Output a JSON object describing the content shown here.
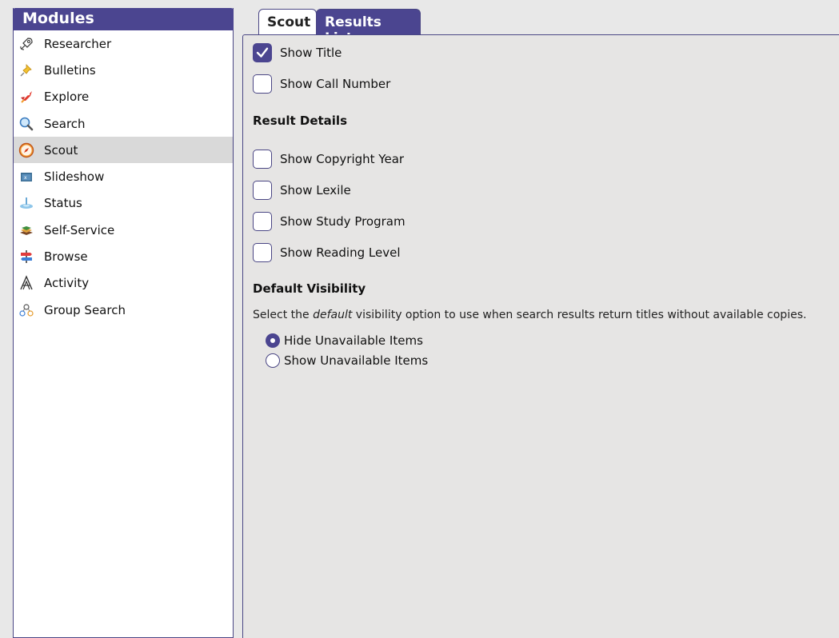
{
  "sidebar": {
    "header": "Modules",
    "items": [
      {
        "label": "Researcher",
        "icon": "rocket-outline-icon"
      },
      {
        "label": "Bulletins",
        "icon": "pushpin-icon"
      },
      {
        "label": "Explore",
        "icon": "rocket-icon"
      },
      {
        "label": "Search",
        "icon": "magnifier-icon"
      },
      {
        "label": "Scout",
        "icon": "compass-icon",
        "selected": true
      },
      {
        "label": "Slideshow",
        "icon": "slideshow-icon"
      },
      {
        "label": "Status",
        "icon": "status-icon"
      },
      {
        "label": "Self-Service",
        "icon": "books-icon"
      },
      {
        "label": "Browse",
        "icon": "signpost-icon"
      },
      {
        "label": "Activity",
        "icon": "activity-a-icon"
      },
      {
        "label": "Group Search",
        "icon": "group-icon"
      }
    ]
  },
  "tabs": [
    {
      "label": "Scout",
      "active": false
    },
    {
      "label": "Results List",
      "active": true
    }
  ],
  "content": {
    "show_title": {
      "label": "Show Title",
      "checked": true
    },
    "show_call_number": {
      "label": "Show Call Number",
      "checked": false
    },
    "result_details_title": "Result Details",
    "show_copyright_year": {
      "label": "Show Copyright Year",
      "checked": false
    },
    "show_lexile": {
      "label": "Show Lexile",
      "checked": false
    },
    "show_study_program": {
      "label": "Show Study Program",
      "checked": false
    },
    "show_reading_level": {
      "label": "Show Reading Level",
      "checked": false
    },
    "default_visibility_title": "Default Visibility",
    "desc_prefix": "Select the ",
    "desc_em": "default",
    "desc_suffix": " visibility option to use when search results return titles without available copies.",
    "hide_unavailable": {
      "label": "Hide Unavailable Items",
      "selected": true
    },
    "show_unavailable": {
      "label": "Show Unavailable Items",
      "selected": false
    }
  },
  "colors": {
    "accent": "#4b4590",
    "panel_bg": "#e6e5e4",
    "selected_row": "#d9d9d9"
  }
}
